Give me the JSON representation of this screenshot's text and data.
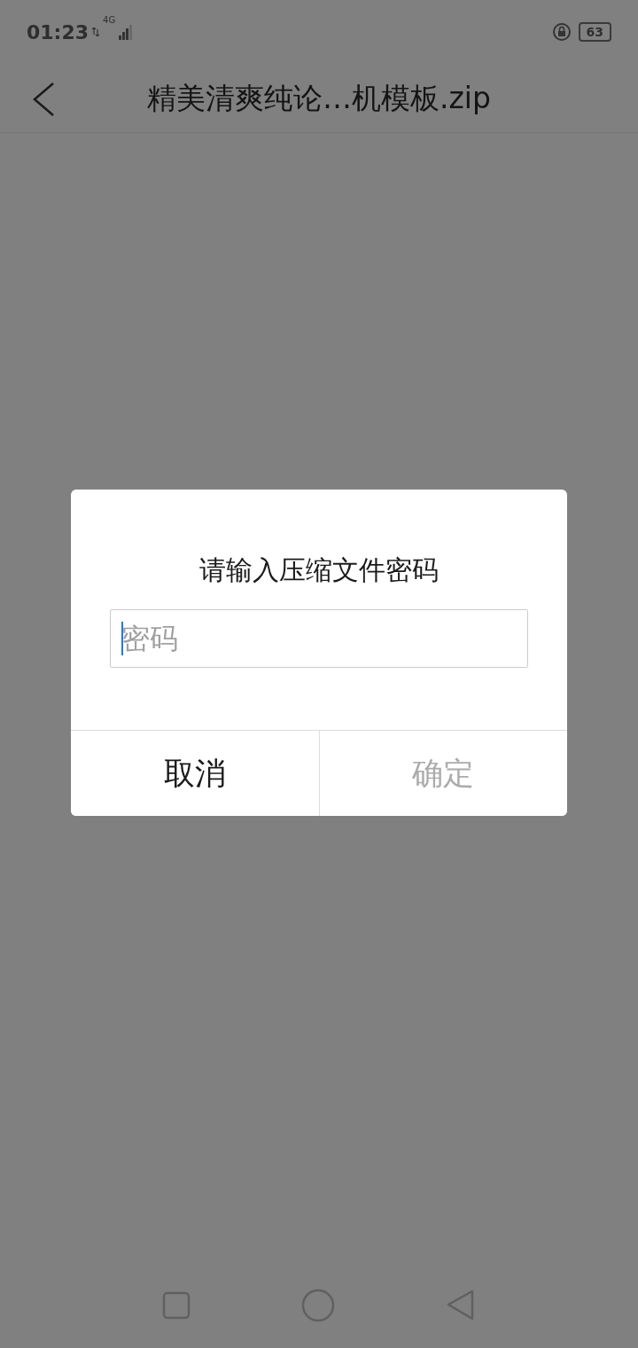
{
  "status_bar": {
    "time": "01:23",
    "network": "4G",
    "battery": "63"
  },
  "header": {
    "title": "精美清爽纯论…机模板.zip"
  },
  "dialog": {
    "title": "请输入压缩文件密码",
    "password_field": {
      "placeholder": "密码",
      "focused": true
    },
    "buttons": [
      {
        "label": "取消",
        "disabled": false
      },
      {
        "label": "确定",
        "disabled": true
      }
    ]
  }
}
